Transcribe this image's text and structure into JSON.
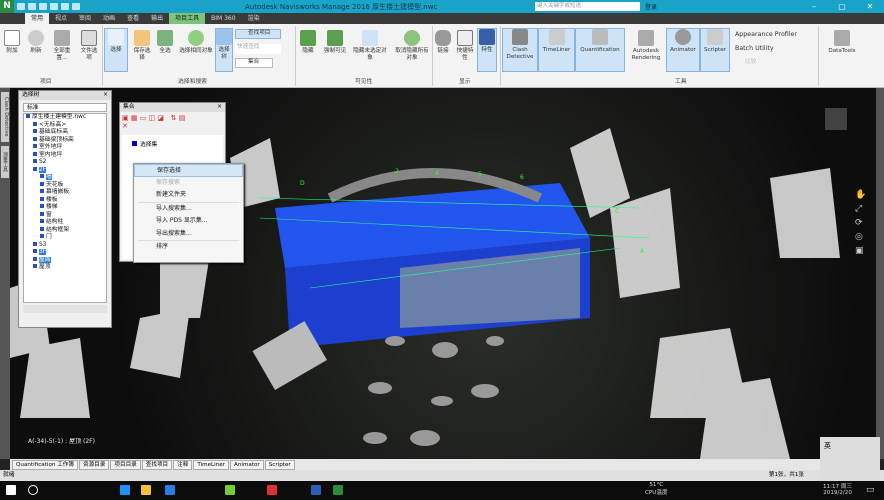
{
  "window": {
    "title": "Autodesk Navisworks Manage 2016    厚生楼土建模型.nwc",
    "search_placeholder": "键入关键字或短语",
    "login": "登录",
    "logo": "N"
  },
  "tabs": [
    "常用",
    "视点",
    "审阅",
    "动画",
    "查看",
    "输出",
    "项目工具",
    "BIM 360",
    "渲染"
  ],
  "ribbon": {
    "project": {
      "label": "项目",
      "buttons": [
        "附加",
        "刷新",
        "全部重置...",
        "文件选项"
      ]
    },
    "select": {
      "label": "选择和搜索",
      "buttons": [
        "选择",
        "保存选择",
        "全选",
        "选择相同对象",
        "选择树"
      ],
      "find": "查找项目",
      "quick_find_placeholder": "快速查找",
      "sets": "集合"
    },
    "visibility": {
      "label": "可见性",
      "buttons": [
        "隐藏",
        "强制可见",
        "隐藏未选定对象",
        "取消隐藏所有对象"
      ]
    },
    "display": {
      "label": "显示",
      "buttons": [
        "链接",
        "快捷特性",
        "特性"
      ]
    },
    "tools": {
      "label": "工具",
      "buttons": [
        "Clash Detective",
        "TimeLiner",
        "Quantification",
        "Autodesk Rendering",
        "Animator",
        "Scripter"
      ],
      "small": [
        "Appearance Profiler",
        "Batch Utility",
        "比较"
      ]
    },
    "datatools": "DataTools"
  },
  "side_tabs": [
    "Clash Detective",
    "测量工具"
  ],
  "selection_tree": {
    "title": "选择树",
    "mode": "标准",
    "nodes": [
      {
        "label": "厚生楼土建模型.nwc",
        "level": 0
      },
      {
        "label": "<无标高>",
        "level": 1
      },
      {
        "label": "基础底标高",
        "level": 1
      },
      {
        "label": "基础梁顶标高",
        "level": 1
      },
      {
        "label": "室外地坪",
        "level": 1
      },
      {
        "label": "室内地坪",
        "level": 1
      },
      {
        "label": "S2",
        "level": 1
      },
      {
        "label": "2F",
        "level": 1,
        "hl": true
      },
      {
        "label": "墙",
        "level": 2,
        "hl": true
      },
      {
        "label": "天花板",
        "level": 2
      },
      {
        "label": "幕墙嵌板",
        "level": 2
      },
      {
        "label": "楼板",
        "level": 2
      },
      {
        "label": "楼梯",
        "level": 2
      },
      {
        "label": "窗",
        "level": 2
      },
      {
        "label": "结构柱",
        "level": 2
      },
      {
        "label": "结构框架",
        "level": 2
      },
      {
        "label": "门",
        "level": 2
      },
      {
        "label": "S3",
        "level": 1
      },
      {
        "label": "3F",
        "level": 1,
        "hl": true
      },
      {
        "label": "屋面",
        "level": 1,
        "hl": true
      },
      {
        "label": "屋顶",
        "level": 1
      }
    ]
  },
  "sets_panel": {
    "title": "集合",
    "item": "选择集"
  },
  "context_menu": [
    {
      "label": "保存选择",
      "state": "hover"
    },
    {
      "label": "保存搜索",
      "state": "disabled"
    },
    {
      "label": "新建文件夹",
      "state": "normal",
      "sep": true
    },
    {
      "label": "导入搜索集...",
      "state": "normal"
    },
    {
      "label": "导入 PDS 显示集...",
      "state": "normal"
    },
    {
      "label": "导出搜索集...",
      "state": "normal",
      "sep": true
    },
    {
      "label": "排序",
      "state": "normal"
    }
  ],
  "viewport": {
    "coords": "A(-34)-5(-1) : 屋顶 (2F)",
    "grid_labels": [
      "D",
      "C",
      "B",
      "2",
      "3",
      "4",
      "5",
      "6",
      "A",
      "C",
      "D",
      "B",
      "2",
      "3",
      "4",
      "5",
      "6"
    ]
  },
  "bottom_tabs": [
    "Quantification 工作簿",
    "资源目录",
    "项目目录",
    "查找项目",
    "注释",
    "TimeLiner",
    "Animator",
    "Scripter"
  ],
  "status": {
    "text": "就绪",
    "pager": "第1张，共1张"
  },
  "taskbar": {
    "temp": "51°C",
    "temp_label": "CPU温度",
    "time": "11:17 周三",
    "date": "2019/2/20",
    "ime": "英"
  }
}
